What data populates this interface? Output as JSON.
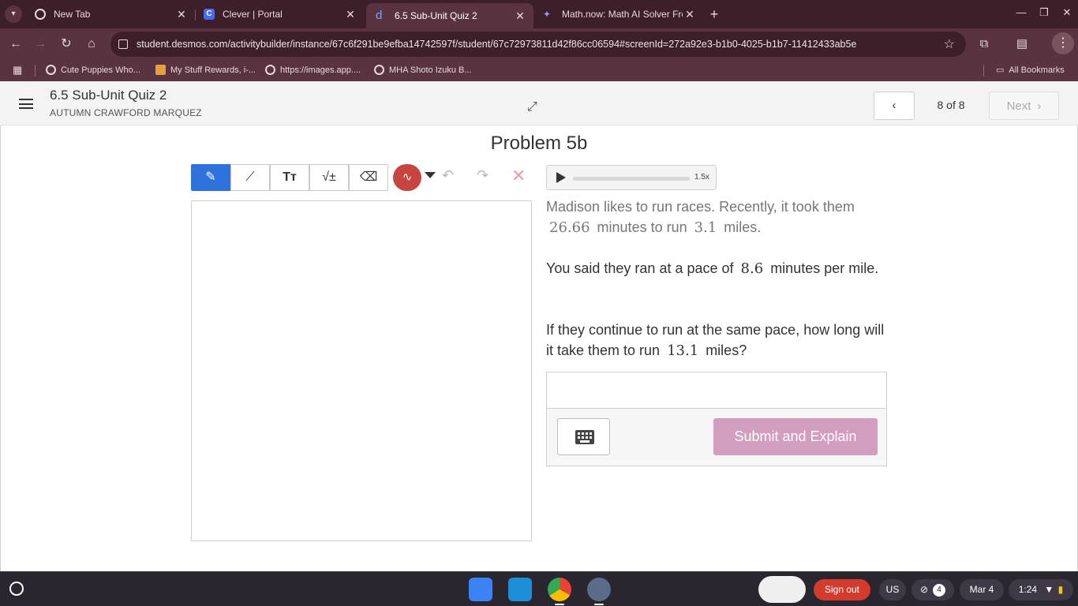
{
  "browser": {
    "tabs": [
      {
        "title": "New Tab",
        "active": false
      },
      {
        "title": "Clever | Portal",
        "active": false
      },
      {
        "title": "6.5 Sub-Unit Quiz 2",
        "active": true
      },
      {
        "title": "Math.now: Math AI Solver Free",
        "active": false
      }
    ],
    "url": "student.desmos.com/activitybuilder/instance/67c6f291be9efba14742597f/student/67c72973811d42f86cc06594#screenId=272a92e3-b1b0-4025-b1b7-11412433ab5e",
    "bookmarks": [
      {
        "label": "Cute Puppies Who..."
      },
      {
        "label": "My Stuff Rewards, i-..."
      },
      {
        "label": "https://images.app...."
      },
      {
        "label": "MHA Shoto Izuku B..."
      }
    ],
    "all_bookmarks": "All Bookmarks"
  },
  "app_header": {
    "quiz_title": "6.5 Sub-Unit Quiz 2",
    "student_name": "AUTUMN CRAWFORD MARQUEZ",
    "page_count": "8 of 8",
    "next_label": "Next"
  },
  "problem": {
    "title": "Problem 5b",
    "audio_speed": "1.5x",
    "p1_a": "Madison likes to run races. Recently, it took them",
    "p1_m1": "26.66",
    "p1_b": "minutes to run",
    "p1_m2": "3.1",
    "p1_c": "miles.",
    "p2_a": "You said they ran at a pace of",
    "p2_m1": "8.6",
    "p2_b": "minutes per mile.",
    "p3_a": "If they continue to run at the same pace, how long will it take them to run",
    "p3_m1": "13.1",
    "p3_b": "miles?",
    "submit_label": "Submit and Explain"
  },
  "shelf": {
    "signout_label": "Sign out",
    "locale": "US",
    "notification_count": "4",
    "date": "Mar 4",
    "time": "1:24"
  },
  "colors": {
    "tab_bg": "#3c1f29",
    "toolbar_bg": "#5a3340",
    "active_tool": "#2f72dc",
    "pen_color": "#c74440",
    "submit_bg": "#d39dbf",
    "signout_bg": "#d33b2c"
  }
}
